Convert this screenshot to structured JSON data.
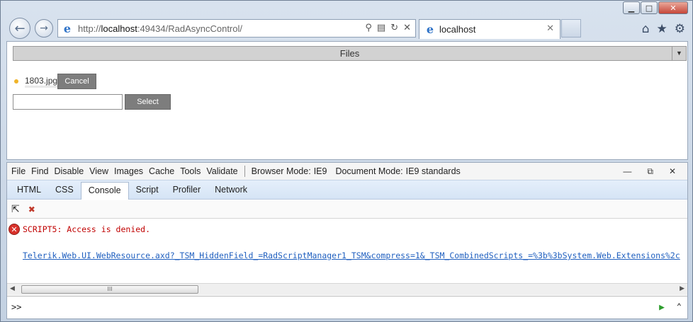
{
  "window": {
    "minimize": "▭",
    "maximize": "□",
    "close": "✕"
  },
  "browser": {
    "url_prefix": "http://",
    "url_host": "localhost",
    "url_rest": ":49434/RadAsyncControl/",
    "tab_title": "localhost",
    "icons": [
      "back-icon",
      "forward-icon",
      "ie-logo-icon",
      "search-icon",
      "compatibility-icon",
      "refresh-icon",
      "stop-icon",
      "close-icon",
      "home-icon",
      "favorites-icon",
      "tools-icon"
    ]
  },
  "page": {
    "files_label": "Files",
    "file_name": "1803.jpg",
    "cancel_label": "Cancel",
    "select_label": "Select",
    "file_input_value": ""
  },
  "devtools": {
    "menu": [
      "File",
      "Find",
      "Disable",
      "View",
      "Images",
      "Cache",
      "Tools",
      "Validate"
    ],
    "browser_mode_label": "Browser Mode:",
    "browser_mode_value": "IE9",
    "document_mode_label": "Document Mode:",
    "document_mode_value": "IE9 standards",
    "tabs": [
      "HTML",
      "CSS",
      "Console",
      "Script",
      "Profiler",
      "Network"
    ],
    "active_tab": "Console",
    "error_text": "SCRIPT5: Access is denied.",
    "link_text": "Telerik.Web.UI.WebResource.axd?_TSM_HiddenField_=RadScriptManager1_TSM&compress=1&_TSM_CombinedScripts_=%3b%3bSystem.Web.Extensions%2c",
    "console_prompt": ">>",
    "scroll_grip": "III"
  }
}
